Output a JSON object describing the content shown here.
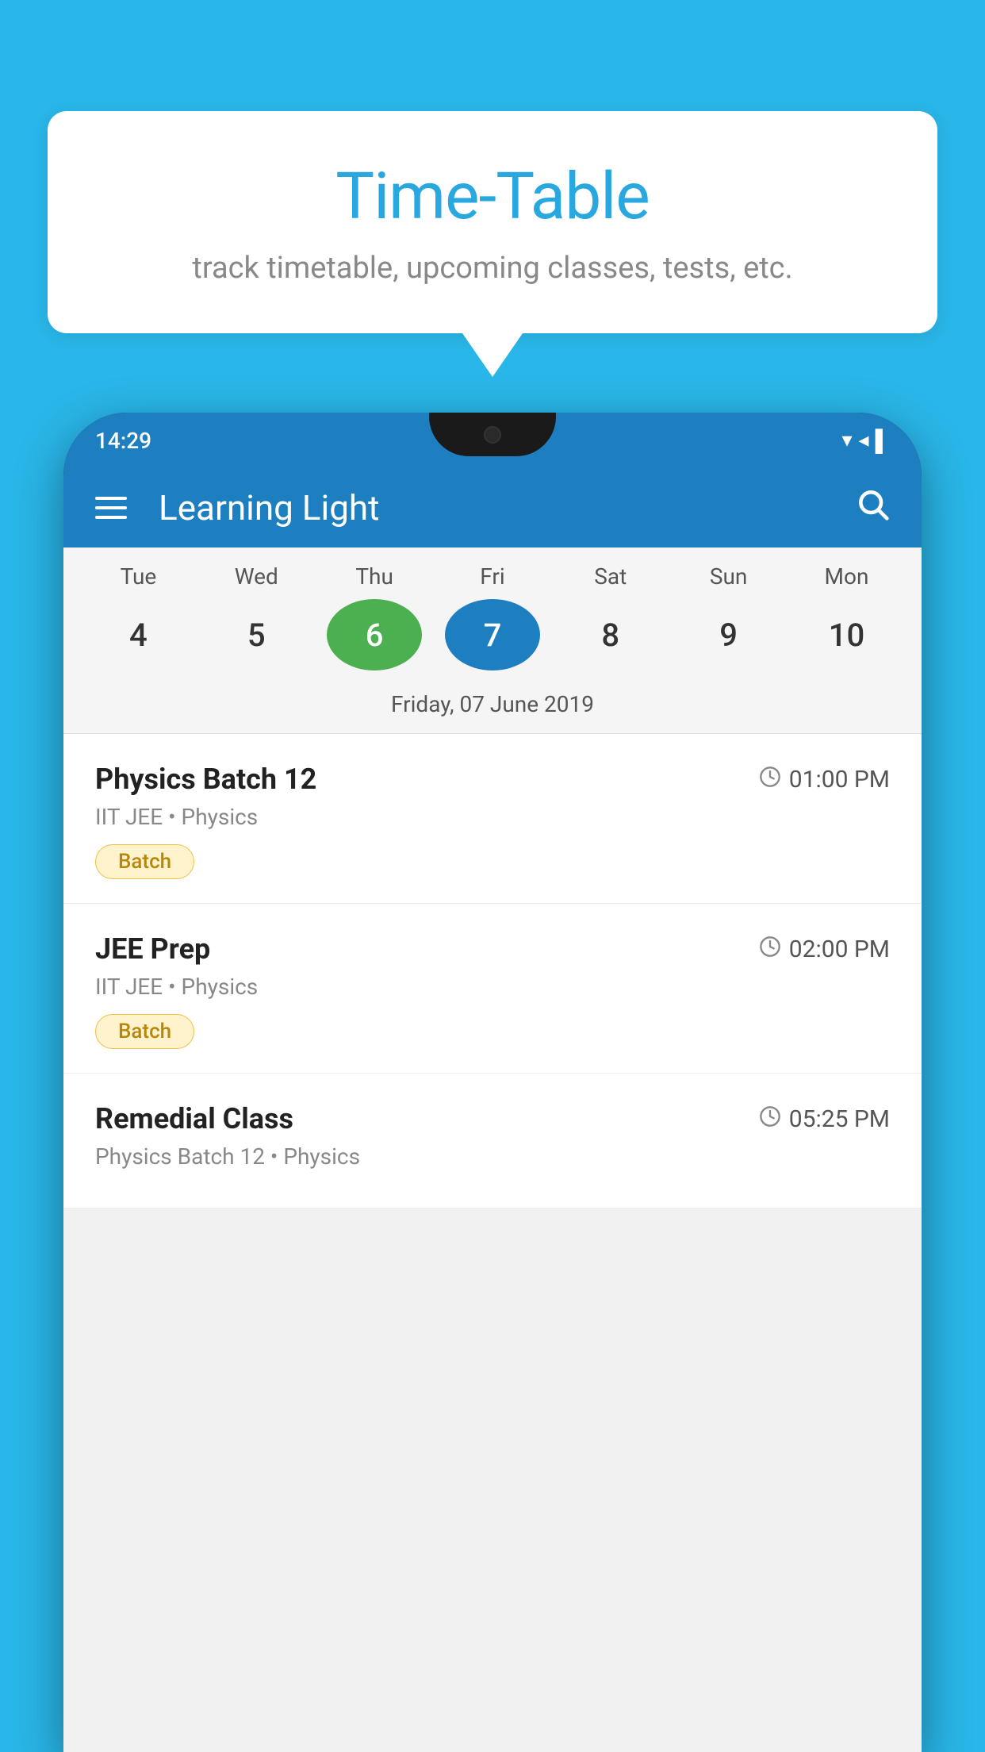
{
  "background_color": "#29b6e8",
  "speech_bubble": {
    "title": "Time-Table",
    "subtitle": "track timetable, upcoming classes, tests, etc."
  },
  "phone": {
    "status_bar": {
      "time": "14:29"
    },
    "app_header": {
      "title": "Learning Light"
    },
    "calendar": {
      "days": [
        {
          "name": "Tue",
          "number": "4",
          "state": "normal"
        },
        {
          "name": "Wed",
          "number": "5",
          "state": "normal"
        },
        {
          "name": "Thu",
          "number": "6",
          "state": "today"
        },
        {
          "name": "Fri",
          "number": "7",
          "state": "selected"
        },
        {
          "name": "Sat",
          "number": "8",
          "state": "normal"
        },
        {
          "name": "Sun",
          "number": "9",
          "state": "normal"
        },
        {
          "name": "Mon",
          "number": "10",
          "state": "normal"
        }
      ],
      "selected_date_label": "Friday, 07 June 2019"
    },
    "classes": [
      {
        "name": "Physics Batch 12",
        "time": "01:00 PM",
        "meta": "IIT JEE • Physics",
        "badge": "Batch"
      },
      {
        "name": "JEE Prep",
        "time": "02:00 PM",
        "meta": "IIT JEE • Physics",
        "badge": "Batch"
      },
      {
        "name": "Remedial Class",
        "time": "05:25 PM",
        "meta": "Physics Batch 12 • Physics",
        "badge": null
      }
    ]
  }
}
